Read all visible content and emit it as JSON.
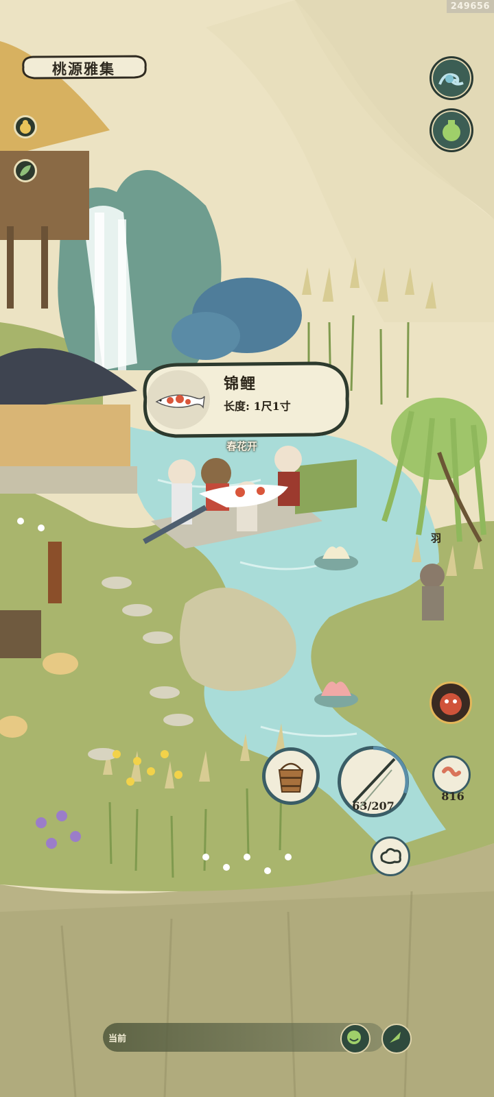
{
  "header": {
    "location_title": "桃源雅集",
    "build_id": "249656"
  },
  "popup": {
    "fish_name": "锦鲤",
    "length_label": "长度: 1尺1寸"
  },
  "characters": {
    "npc_label_center": "春花开",
    "npc_label_right": "羽"
  },
  "fishing": {
    "rod_durability": "63/207",
    "rod_durability_value": 63,
    "rod_durability_max": 207,
    "bait_count": "816"
  },
  "bottom_bar": {
    "current_label": "当前"
  },
  "icons": {
    "left_menu": [
      "gourd-icon",
      "leaf-icon"
    ],
    "right_menu": [
      "wave-icon",
      "jar-icon"
    ],
    "actions": [
      "bucket-icon",
      "fishing-rod-icon",
      "worm-bait-icon",
      "cloud-icon",
      "monster-face-icon",
      "smile-icon",
      "feather-pen-icon"
    ]
  },
  "colors": {
    "water": "#a9dcd8",
    "grass": "#a7b56a",
    "cliff": "#b8b183",
    "sky": "#ece3c3",
    "ink_dark": "#2d3a2e"
  }
}
